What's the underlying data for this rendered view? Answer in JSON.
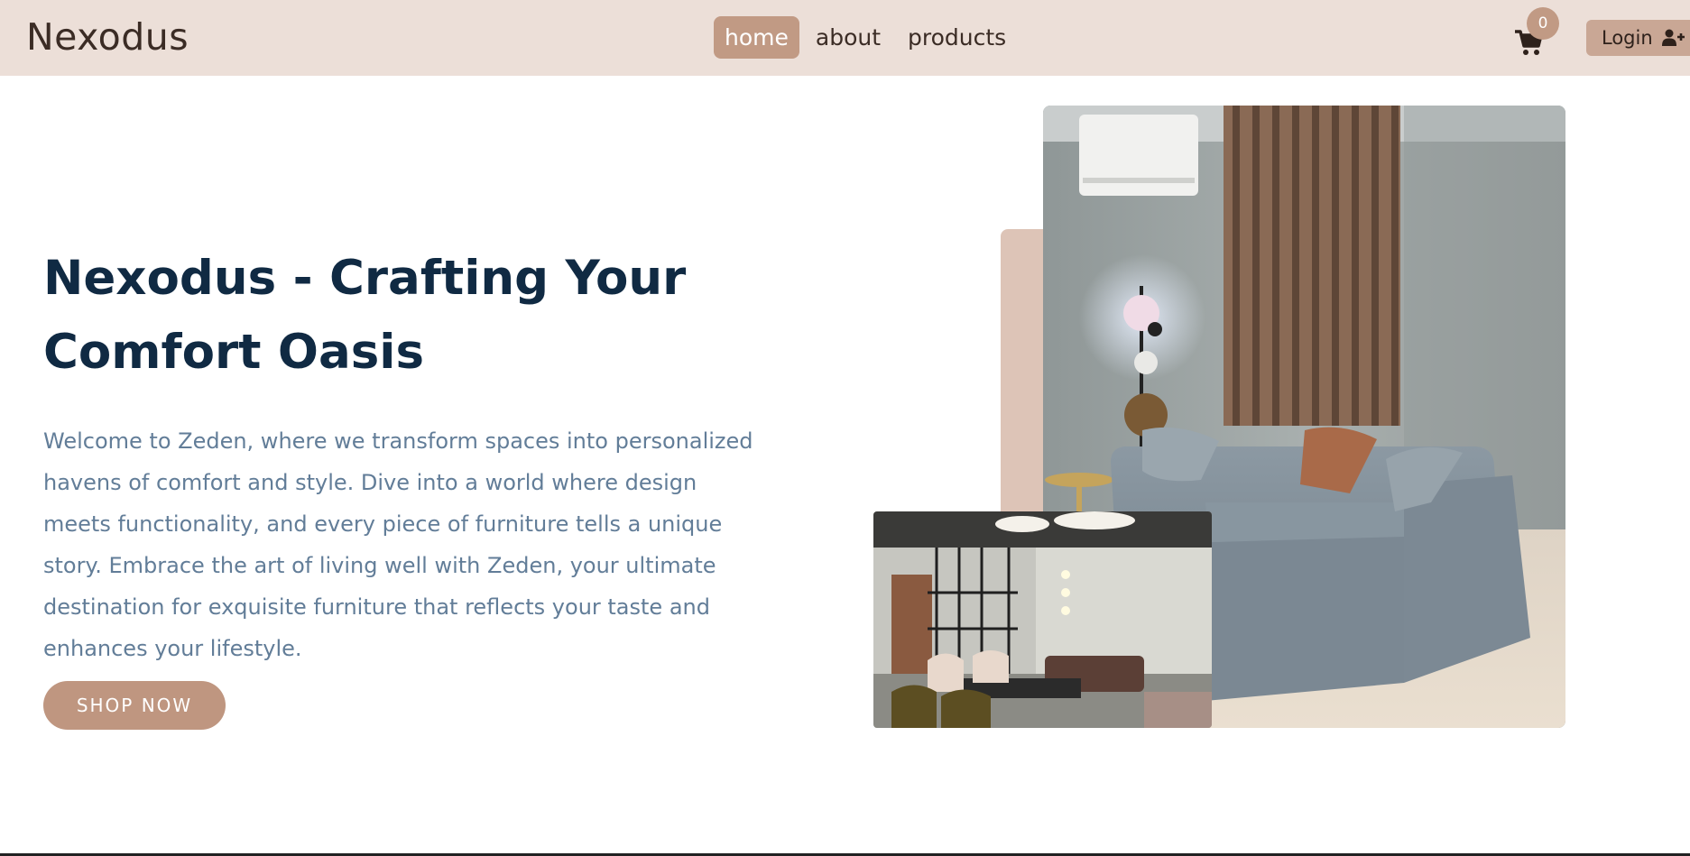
{
  "header": {
    "brand": "Nexodus",
    "nav": [
      {
        "label": "home",
        "active": true
      },
      {
        "label": "about",
        "active": false
      },
      {
        "label": "products",
        "active": false
      }
    ],
    "cart_count": "0",
    "cart_icon": "cart-icon",
    "login_label": "Login",
    "login_icon": "user-plus-icon"
  },
  "hero": {
    "title_line1": "Nexodus - Crafting Your",
    "title_line2": "Comfort Oasis",
    "description": "Welcome to Zeden, where we transform spaces into personalized havens of comfort and style. Dive into a world where design meets functionality, and every piece of furniture tells a unique story. Embrace the art of living well with Zeden, your ultimate destination for exquisite furniture that reflects your taste and enhances your lifestyle.",
    "cta_label": "SHOP NOW"
  },
  "colors": {
    "navbar_bg": "#ecdfd8",
    "accent": "#c19a84",
    "heading": "#102a43",
    "body_text": "#627d98"
  }
}
